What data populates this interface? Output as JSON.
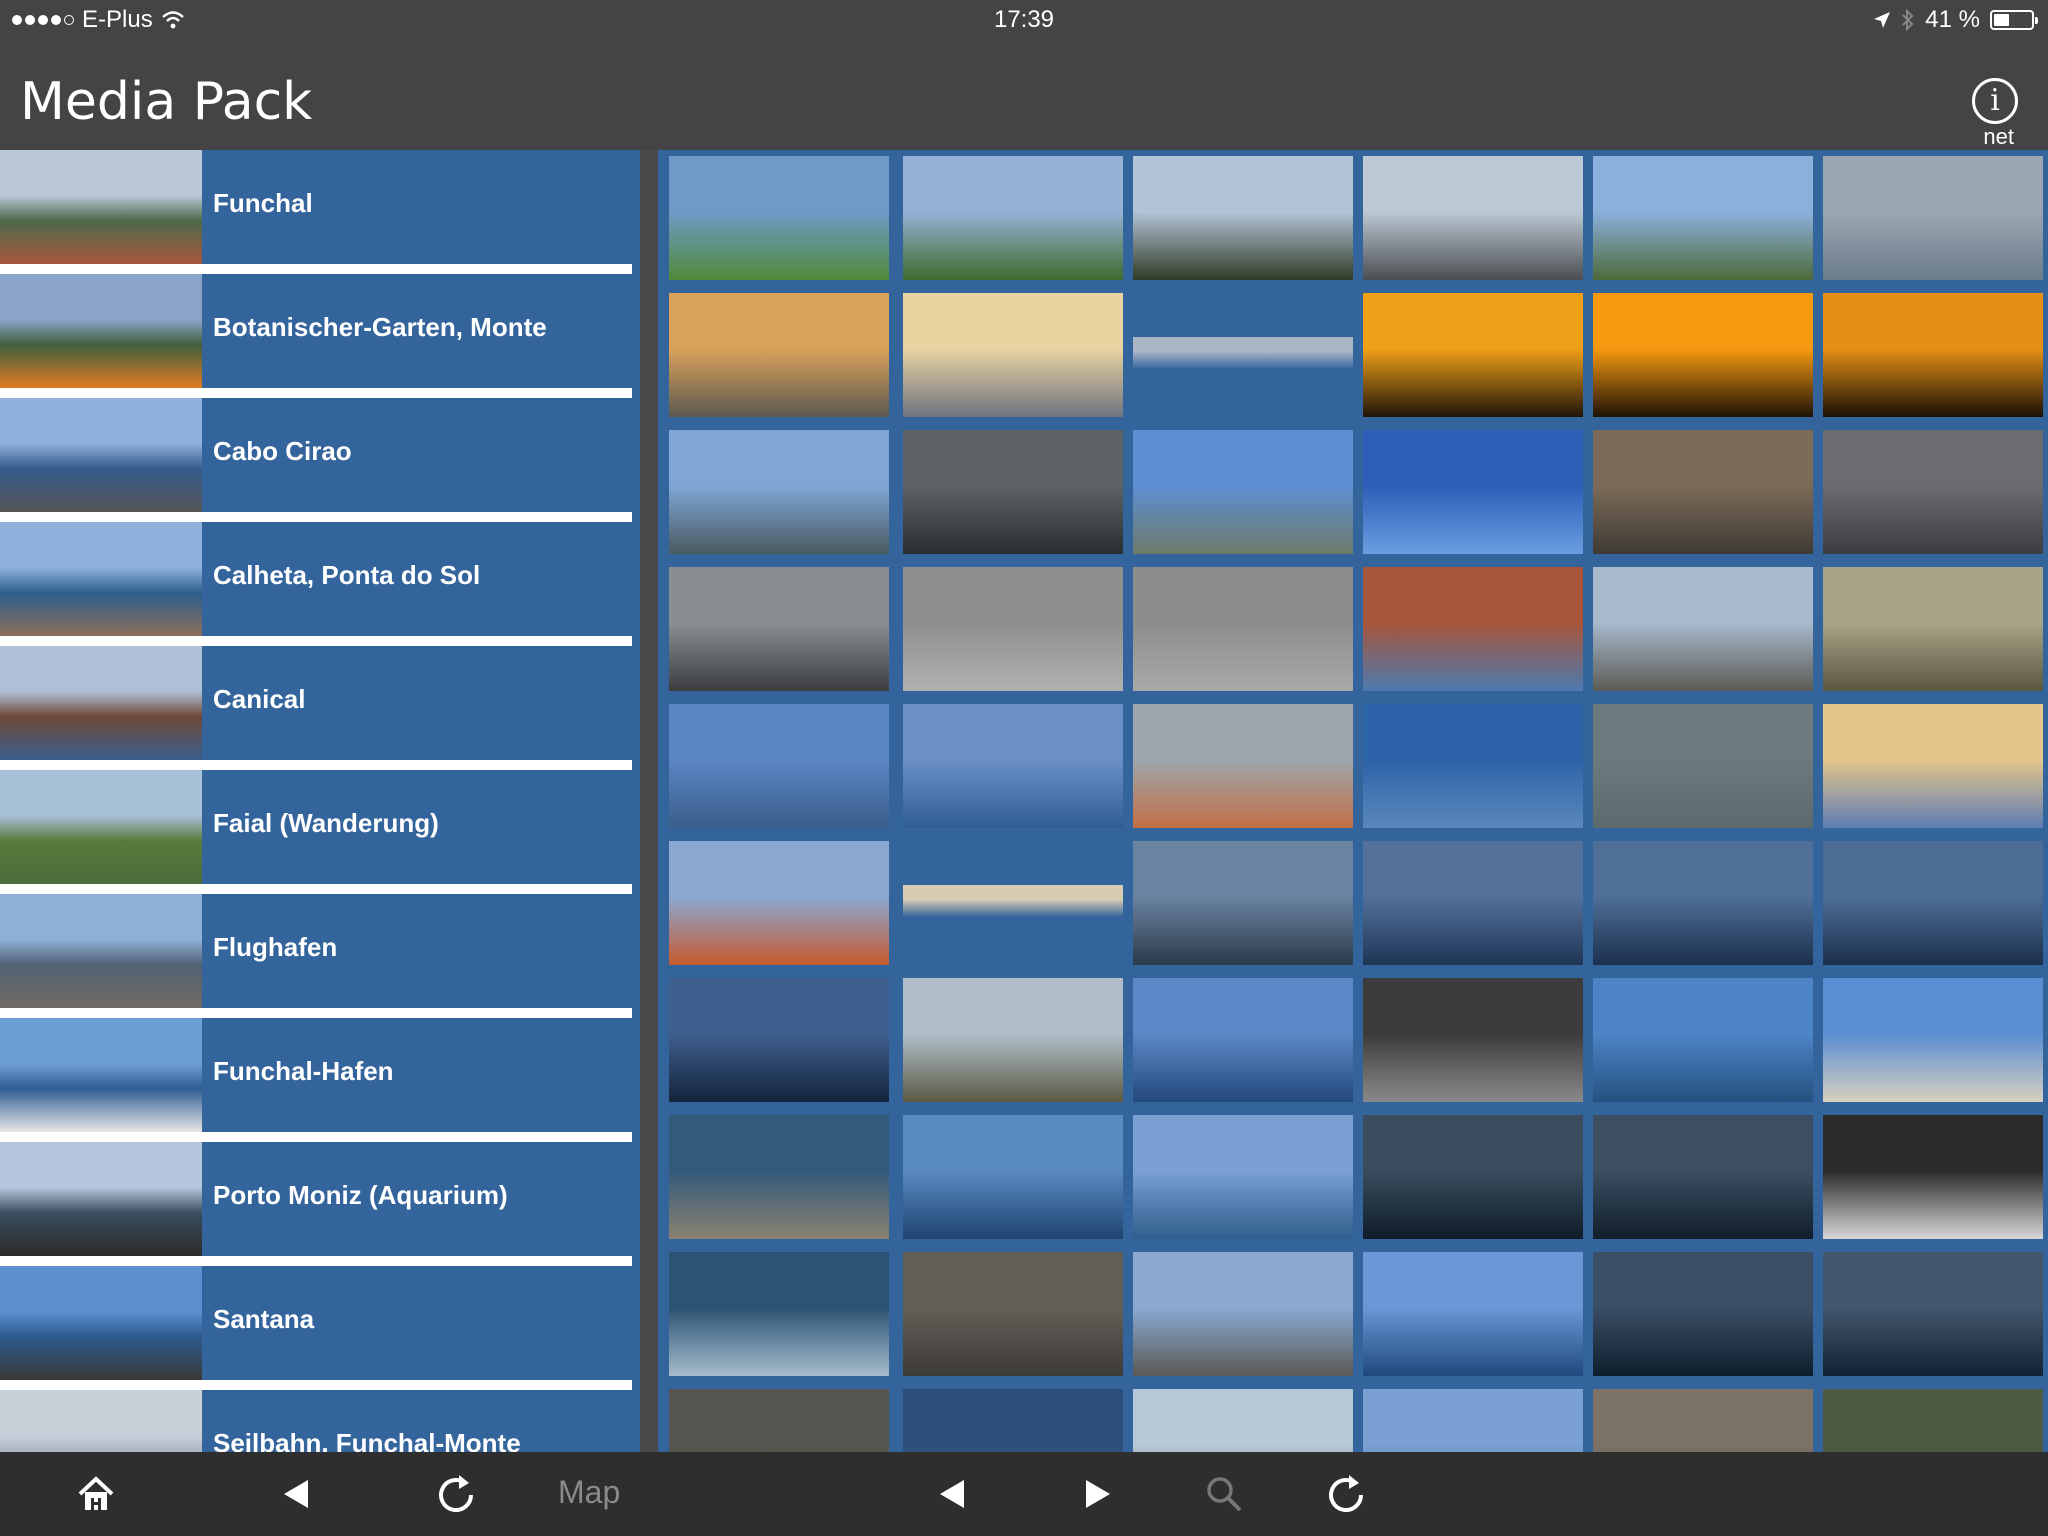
{
  "status": {
    "carrier": "E-Plus",
    "time": "17:39",
    "battery": "41 %",
    "battery_level": 0.41
  },
  "header": {
    "title": "Media Pack",
    "info_label": "net"
  },
  "albums": [
    {
      "label": "Funchal",
      "colors": [
        "#b9c7d8",
        "#4c6a4a",
        "#a9573d"
      ]
    },
    {
      "label": "Botanischer-Garten, Monte",
      "colors": [
        "#8ba3c8",
        "#3f5f3f",
        "#e07b21"
      ]
    },
    {
      "label": "Cabo Cirao",
      "colors": [
        "#8fb0da",
        "#355a8c",
        "#555"
      ]
    },
    {
      "label": "Calheta, Ponta do Sol",
      "colors": [
        "#8fb0da",
        "#2c5f8c",
        "#8d6d5b"
      ]
    },
    {
      "label": "Canical",
      "colors": [
        "#aebfd6",
        "#6e4a3a",
        "#3c5e8c"
      ]
    },
    {
      "label": "Faial (Wanderung)",
      "colors": [
        "#a9c0d9",
        "#587c3d",
        "#4a6d3a"
      ]
    },
    {
      "label": "Flughafen",
      "colors": [
        "#8eb0d8",
        "#536173",
        "#6f6a65"
      ]
    },
    {
      "label": "Funchal-Hafen",
      "colors": [
        "#6e9ed6",
        "#2f5e93",
        "#e7e7e7"
      ]
    },
    {
      "label": "Porto Moniz (Aquarium)",
      "colors": [
        "#b4c6dc",
        "#3a4e5e",
        "#2b2b2b"
      ]
    },
    {
      "label": "Santana",
      "colors": [
        "#5c8fd0",
        "#2d5a8d",
        "#3a3a3a"
      ]
    },
    {
      "label": "Seilbahn, Funchal-Monte",
      "colors": [
        "#c8d0da",
        "#9aa6b3",
        "#444"
      ]
    }
  ],
  "thumbs": [
    [
      "#6f9ac8",
      "#4f8a3a"
    ],
    [
      "#95b2d4",
      "#3d6b2f"
    ],
    [
      "#b4c4d6",
      "#2e3b26"
    ],
    [
      "#bcc8d4",
      "#4a4e52"
    ],
    [
      "#8cb0dc",
      "#4d6a3a"
    ],
    [
      "#9aa6b2",
      "#6c7c8a"
    ],
    [
      "#d9a25a",
      "#5c5a52"
    ],
    [
      "#e8d3a0",
      "#6f7480"
    ],
    [
      "#aab6c6",
      "#34649c"
    ],
    [
      "#f0a018",
      "#1f1408"
    ],
    [
      "#f59a10",
      "#1e1105"
    ],
    [
      "#e49016",
      "#1a0f05"
    ],
    [
      "#7fa6d6",
      "#4a5a60"
    ],
    [
      "#5e6266",
      "#2a2d30"
    ],
    [
      "#5d8fd2",
      "#6c7a6a"
    ],
    [
      "#2d5eb8",
      "#6a9ee0"
    ],
    [
      "#7b6b58",
      "#3f3a35"
    ],
    [
      "#6a6c70",
      "#3c3d40"
    ],
    [
      "#8a8e92",
      "#3c3e40"
    ],
    [
      "#8e9090",
      "#b0b2b2"
    ],
    [
      "#8c8e8e",
      "#a8aaaa"
    ],
    [
      "#a6553a",
      "#4d7ab0"
    ],
    [
      "#a7b9cc",
      "#5b5b55"
    ],
    [
      "#a8a488",
      "#5a5640"
    ],
    [
      "#5b86c4",
      "#3b5f8a"
    ],
    [
      "#6a90c6",
      "#2f5d93"
    ],
    [
      "#9ea6ad",
      "#c26f45"
    ],
    [
      "#2d63a8",
      "#5a88bc"
    ],
    [
      "#6d7a7d",
      "#5c6a6d"
    ],
    [
      "#e4c58c",
      "#5d7db2"
    ],
    [
      "#8aa8d2",
      "#c65a2e"
    ],
    [
      "#d8cdb3",
      "#34649c"
    ],
    [
      "#6a83a0",
      "#2c3a4a"
    ],
    [
      "#52709a",
      "#1f3555"
    ],
    [
      "#4f6f98",
      "#1b304d"
    ],
    [
      "#4d6d96",
      "#1a2f4a"
    ],
    [
      "#3f5f8f",
      "#14243b"
    ],
    [
      "#b0beca",
      "#5b5a44"
    ],
    [
      "#5b88c6",
      "#24497c"
    ],
    [
      "#3c3c3c",
      "#8a8a8a"
    ],
    [
      "#4d84c6",
      "#24517f"
    ],
    [
      "#5a8ed2",
      "#d8d0c0"
    ],
    [
      "#335a7a",
      "#8a8270"
    ],
    [
      "#5a8ac2",
      "#1f4470"
    ],
    [
      "#7aa0d4",
      "#2f5e8c"
    ],
    [
      "#3a4c5e",
      "#0f1c2a"
    ],
    [
      "#3b4e62",
      "#101d2b"
    ],
    [
      "#2a2a2a",
      "#d8d8d8"
    ],
    [
      "#2d5373",
      "#a5bccc"
    ],
    [
      "#625f58",
      "#3d3b37"
    ],
    [
      "#8aa8d2",
      "#5b5a55"
    ],
    [
      "#6a98d6",
      "#1f497d"
    ],
    [
      "#3a4e64",
      "#0f1e2e"
    ],
    [
      "#42566c",
      "#132233"
    ],
    [
      "#575550",
      "#3b3a36"
    ],
    [
      "#2b4f7a",
      "#5d80a6"
    ],
    [
      "#b8c8d8",
      "#6a5a48"
    ],
    [
      "#7aa0d4",
      "#3d5a78"
    ],
    [
      "#7c7266",
      "#4a4038"
    ],
    [
      "#4f5a44",
      "#2e342a"
    ]
  ],
  "toolbar": {
    "map_label": "Map"
  }
}
